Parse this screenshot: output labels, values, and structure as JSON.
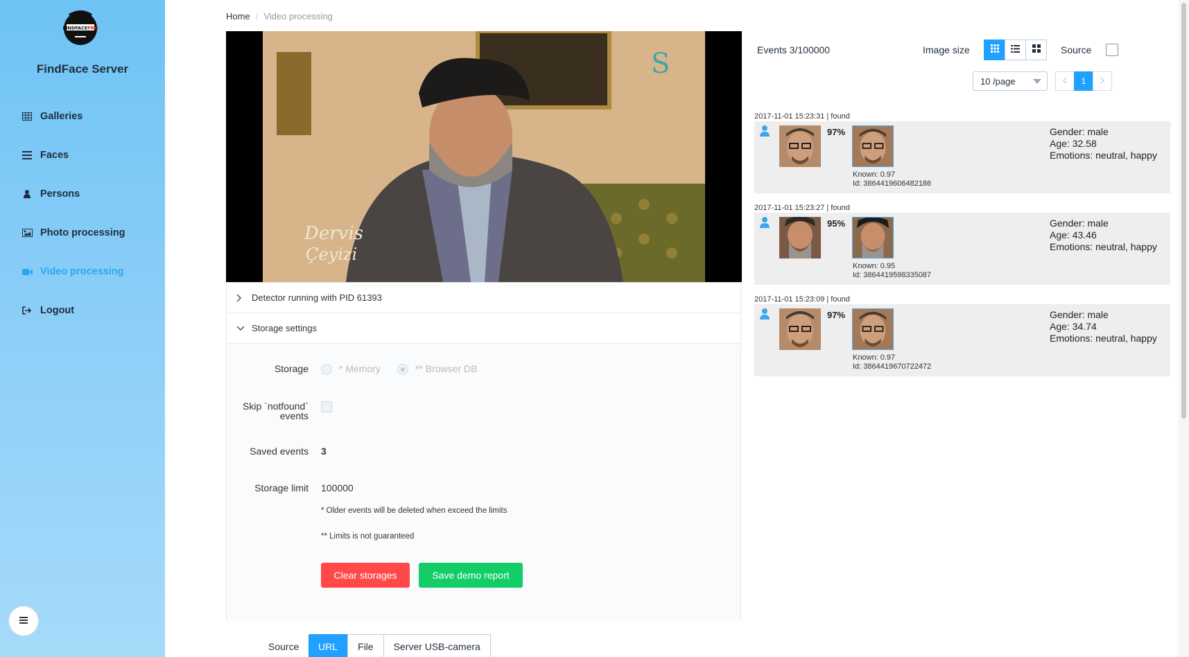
{
  "app": {
    "title": "FindFace Server",
    "logo_text": "FINDFACEPRO"
  },
  "sidebar": {
    "items": [
      {
        "label": "Galleries",
        "icon": "grid-icon",
        "active": false
      },
      {
        "label": "Faces",
        "icon": "list-icon",
        "active": false
      },
      {
        "label": "Persons",
        "icon": "person-icon",
        "active": false
      },
      {
        "label": "Photo processing",
        "icon": "image-icon",
        "active": false
      },
      {
        "label": "Video processing",
        "icon": "video-camera-icon",
        "active": true
      },
      {
        "label": "Logout",
        "icon": "logout-icon",
        "active": false
      }
    ],
    "collapse_icon": "menu-icon"
  },
  "breadcrumb": {
    "home": "Home",
    "separator": "/",
    "current": "Video processing"
  },
  "video": {
    "caption_line1": "Dervis",
    "caption_line2": "Çeyizi",
    "channel_logo": "S"
  },
  "detector": {
    "label": "Detector running with PID 61393"
  },
  "storage": {
    "section_label": "Storage settings",
    "storage_label": "Storage",
    "option_memory": "* Memory",
    "option_browser_db": "** Browser DB",
    "selected": "** Browser DB",
    "skip_label_line1": "Skip `notfound`",
    "skip_label_line2": "events",
    "saved_events_label": "Saved events",
    "saved_events_value": "3",
    "limit_label": "Storage limit",
    "limit_value": "100000",
    "note1": "* Older events will be deleted when exceed the limits",
    "note2": "** Limits is not guaranteed",
    "clear_button": "Clear storages",
    "save_button": "Save demo report"
  },
  "source": {
    "label": "Source",
    "tabs": [
      "URL",
      "File",
      "Server USB-camera"
    ],
    "active": "URL"
  },
  "events": {
    "title": "Events 3/100000",
    "image_size_label": "Image size",
    "source_label": "Source",
    "per_page": "10 /page",
    "page": "1",
    "colors": {
      "accent": "#20a0ff",
      "card_bg": "#eeeeee"
    },
    "items": [
      {
        "header": "2017-11-01 15:23:31 | found",
        "percent": "97%",
        "known": "Known: 0.97",
        "id": "Id: 3864419606482186",
        "gender": "Gender: male",
        "age": "Age: 32.58",
        "emotions": "Emotions: neutral, happy"
      },
      {
        "header": "2017-11-01 15:23:27 | found",
        "percent": "95%",
        "known": "Known: 0.95",
        "id": "Id: 3864419598335087",
        "gender": "Gender: male",
        "age": "Age: 43.46",
        "emotions": "Emotions: neutral, happy"
      },
      {
        "header": "2017-11-01 15:23:09 | found",
        "percent": "97%",
        "known": "Known: 0.97",
        "id": "Id: 3864419670722472",
        "gender": "Gender: male",
        "age": "Age: 34.74",
        "emotions": "Emotions: neutral, happy"
      }
    ]
  }
}
